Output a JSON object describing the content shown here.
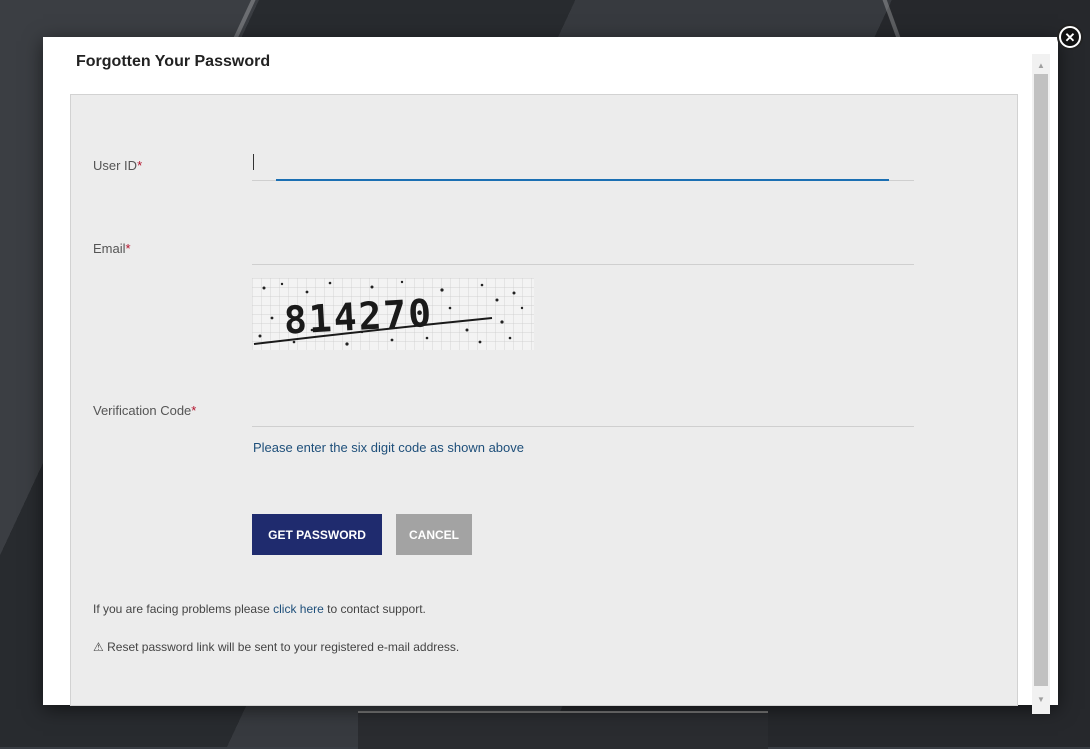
{
  "modal": {
    "title": "Forgotten Your Password"
  },
  "form": {
    "user_id_label": "User ID",
    "email_label": "Email",
    "verification_label": "Verification Code",
    "required_mark": "*",
    "user_id_value": "",
    "email_value": "",
    "verification_value": "",
    "captcha_text": "814270",
    "hint": "Please enter the six digit code as shown above"
  },
  "buttons": {
    "get_password": "GET PASSWORD",
    "cancel": "CANCEL"
  },
  "notes": {
    "support_prefix": "If you are facing problems please ",
    "support_link": "click here",
    "support_suffix": " to contact support.",
    "reset_icon": "⚠",
    "reset_text": " Reset password link will be sent to your registered e-mail address."
  },
  "icons": {
    "close": "close-circle-icon",
    "scroll_up": "triangle-up-icon",
    "scroll_down": "triangle-down-icon",
    "warning": "warning-icon"
  },
  "colors": {
    "primary_button": "#1f2b6e",
    "cancel_button": "#a3a3a3",
    "focus_underline": "#1b6fb3",
    "required": "#b3122c",
    "link": "#1e4f7a"
  }
}
